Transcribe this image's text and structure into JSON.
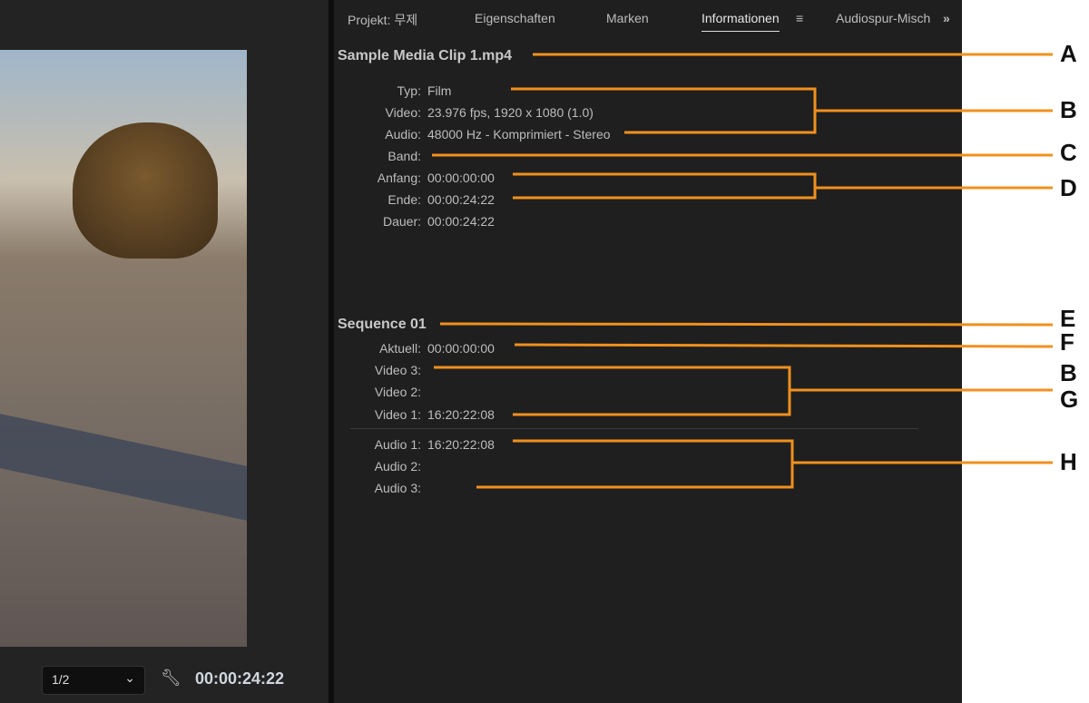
{
  "tabs": {
    "project": "Projekt: 무제",
    "properties": "Eigenschaften",
    "markers": "Marken",
    "info": "Informationen",
    "audio_mixer": "Audiospur-Misch",
    "menu_icon": "≡",
    "more_icon": "»"
  },
  "clip": {
    "title": "Sample Media Clip 1.mp4",
    "rows": [
      {
        "k": "Typ:",
        "v": "Film"
      },
      {
        "k": "Video:",
        "v": "23.976 fps, 1920 x 1080 (1.0)"
      },
      {
        "k": "Audio:",
        "v": "48000 Hz - Komprimiert - Stereo"
      },
      {
        "k": "Band:",
        "v": ""
      },
      {
        "k": "Anfang:",
        "v": "00:00:00:00"
      },
      {
        "k": "Ende:",
        "v": "00:00:24:22"
      },
      {
        "k": "Dauer:",
        "v": "00:00:24:22"
      }
    ]
  },
  "sequence": {
    "title": "Sequence 01",
    "rows": [
      {
        "k": "Aktuell:",
        "v": "00:00:00:00"
      },
      {
        "k": "Video 3:",
        "v": ""
      },
      {
        "k": "Video 2:",
        "v": ""
      },
      {
        "k": "Video 1:",
        "v": "16:20:22:08"
      },
      {
        "k": "Audio 1:",
        "v": "16:20:22:08"
      },
      {
        "k": "Audio 2:",
        "v": ""
      },
      {
        "k": "Audio 3:",
        "v": ""
      }
    ]
  },
  "monitor": {
    "resolution": "1/2",
    "timecode": "00:00:24:22"
  },
  "callouts": [
    "A",
    "B",
    "C",
    "D",
    "E",
    "F",
    "B",
    "G",
    "H"
  ],
  "colors": {
    "callout": "#f0901e"
  }
}
